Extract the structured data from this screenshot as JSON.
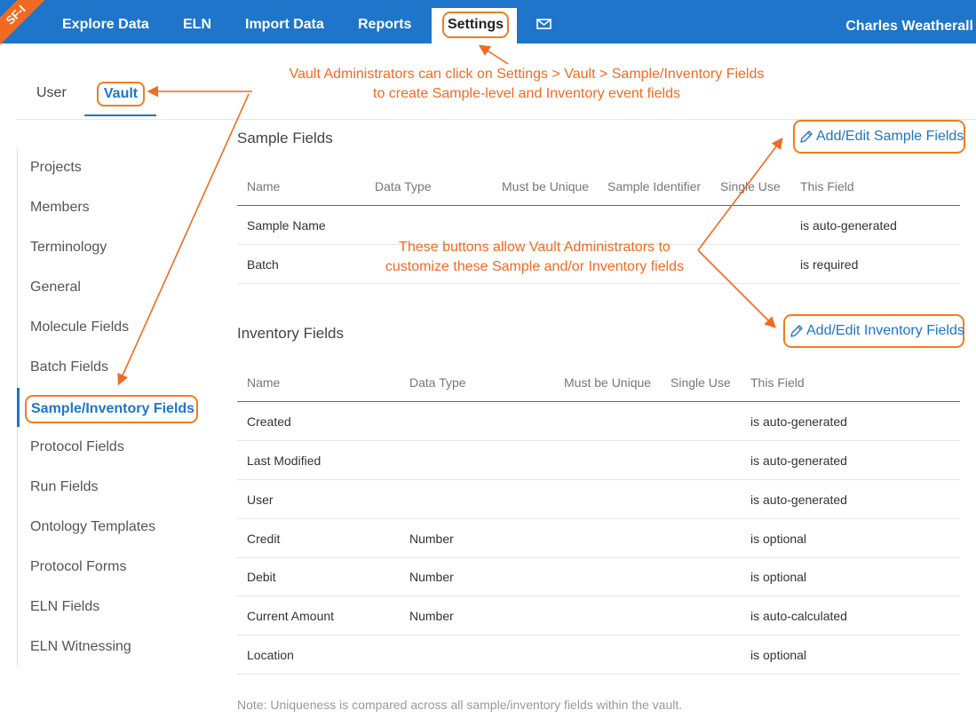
{
  "ribbon": "SF-I",
  "nav": {
    "items": [
      "Explore Data",
      "ELN",
      "Import Data",
      "Reports"
    ],
    "settings": "Settings",
    "mail_icon": "envelope-icon",
    "user": "Charles Weatherall"
  },
  "subtabs": {
    "user": "User",
    "vault": "Vault"
  },
  "sidebar": {
    "items": [
      "Projects",
      "Members",
      "Terminology",
      "General",
      "Molecule Fields",
      "Batch Fields",
      "Sample/Inventory Fields",
      "Protocol Fields",
      "Run Fields",
      "Ontology Templates",
      "Protocol Forms",
      "ELN Fields",
      "ELN Witnessing"
    ],
    "active_index": 6
  },
  "sample": {
    "title": "Sample Fields",
    "add_button": "Add/Edit Sample Fields",
    "headers": [
      "Name",
      "Data Type",
      "Must be Unique",
      "Sample Identifier",
      "Single Use",
      "This Field"
    ],
    "rows": [
      {
        "name": "Sample Name",
        "type": "",
        "status": "is auto-generated"
      },
      {
        "name": "Batch",
        "type": "",
        "status": "is required"
      }
    ]
  },
  "inventory": {
    "title": "Inventory Fields",
    "add_button": "Add/Edit Inventory Fields",
    "headers": [
      "Name",
      "Data Type",
      "Must be Unique",
      "Single Use",
      "This Field"
    ],
    "rows": [
      {
        "name": "Created",
        "type": "",
        "status": "is auto-generated"
      },
      {
        "name": "Last Modified",
        "type": "",
        "status": "is auto-generated"
      },
      {
        "name": "User",
        "type": "",
        "status": "is auto-generated"
      },
      {
        "name": "Credit",
        "type": "Number",
        "status": "is optional"
      },
      {
        "name": "Debit",
        "type": "Number",
        "status": "is optional"
      },
      {
        "name": "Current Amount",
        "type": "Number",
        "status": "is auto-calculated"
      },
      {
        "name": "Location",
        "type": "",
        "status": "is optional"
      }
    ]
  },
  "note": "Note: Uniqueness is compared across all sample/inventory fields within the vault.",
  "annotations": {
    "callout1_line1": "Vault Administrators can click on Settings > Vault > Sample/Inventory Fields",
    "callout1_line2": "to create Sample-level and Inventory event fields",
    "callout2_line1": "These buttons allow Vault Administrators to",
    "callout2_line2": "customize these Sample and/or Inventory fields",
    "color": "#f26a21"
  },
  "colors": {
    "nav_bg": "#1e75c9",
    "accent": "#1e75c9",
    "highlight": "#f07d1f"
  }
}
